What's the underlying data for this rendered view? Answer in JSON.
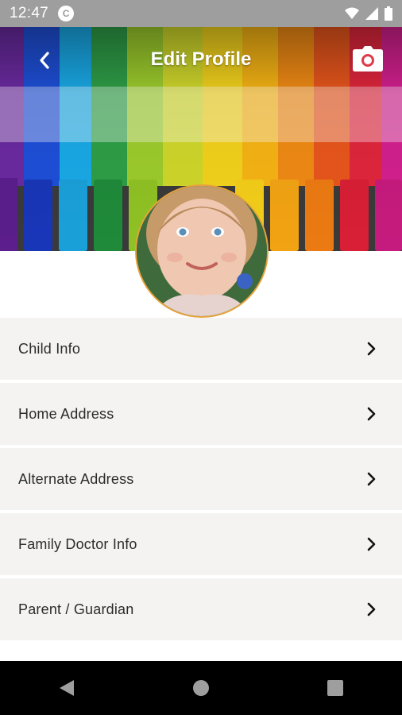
{
  "status_bar": {
    "time": "12:47",
    "app_icon": "app-notification-icon",
    "icons": [
      "wifi-icon",
      "signal-icon",
      "battery-icon"
    ]
  },
  "header": {
    "title": "Edit Profile",
    "back_icon": "chevron-left-icon",
    "camera_icon": "camera-icon",
    "banner_image": "rainbow-chalk-pastels",
    "avatar_image": "child-portrait-photo"
  },
  "menu": {
    "items": [
      {
        "label": "Child Info"
      },
      {
        "label": "Home Address"
      },
      {
        "label": "Alternate Address"
      },
      {
        "label": "Family Doctor Info"
      },
      {
        "label": "Parent / Guardian"
      }
    ]
  },
  "nav_bar": {
    "buttons": [
      "back-triangle-icon",
      "home-circle-icon",
      "recents-square-icon"
    ]
  },
  "colors": {
    "status_bar": "#9e9e9e",
    "menu_item_bg": "#f4f3f1",
    "avatar_border": "#e8a33a",
    "nav_bar": "#000000"
  }
}
